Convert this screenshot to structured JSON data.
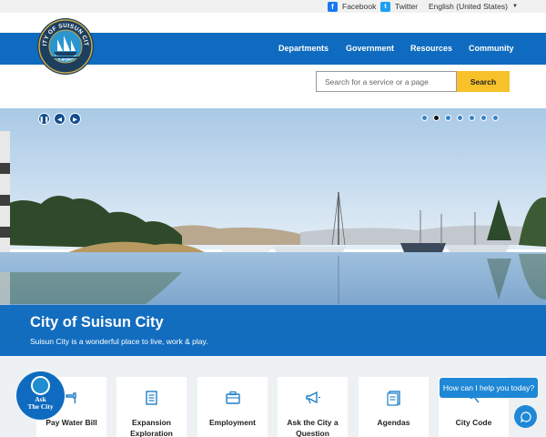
{
  "topbar": {
    "facebook": "Facebook",
    "twitter": "Twitter",
    "language": "English (United States)"
  },
  "logo": {
    "top_text": "CITY OF SUISUN CITY",
    "bottom_text": "CALIFORNIA"
  },
  "nav": {
    "items": [
      {
        "label": "Departments"
      },
      {
        "label": "Government"
      },
      {
        "label": "Resources"
      },
      {
        "label": "Community"
      }
    ]
  },
  "search": {
    "placeholder": "Search for a service or a page",
    "button_label": "Search"
  },
  "hero": {
    "controls": {
      "pause": "pause-icon",
      "prev": "chevron-left-icon",
      "next": "chevron-right-icon"
    },
    "slides_total": 7,
    "active_slide": 2,
    "title": "City of Suisun City",
    "subtitle": "Suisun City is a wonderful place to live, work & play."
  },
  "quick_links": [
    {
      "label": "Pay Water Bill",
      "icon": "faucet-icon"
    },
    {
      "label": "Expansion Exploration",
      "icon": "document-icon"
    },
    {
      "label": "Employment",
      "icon": "briefcase-icon"
    },
    {
      "label": "Ask the City a Question",
      "icon": "megaphone-icon"
    },
    {
      "label": "Agendas",
      "icon": "agenda-icon"
    },
    {
      "label": "City Code",
      "icon": "gavel-icon"
    }
  ],
  "ask_the_city": {
    "line1": "Ask",
    "line2": "The City"
  },
  "chat": {
    "prompt": "How can I help you today?"
  },
  "colors": {
    "brand_blue": "#0f6bbf",
    "accent_yellow": "#f7c12a"
  }
}
